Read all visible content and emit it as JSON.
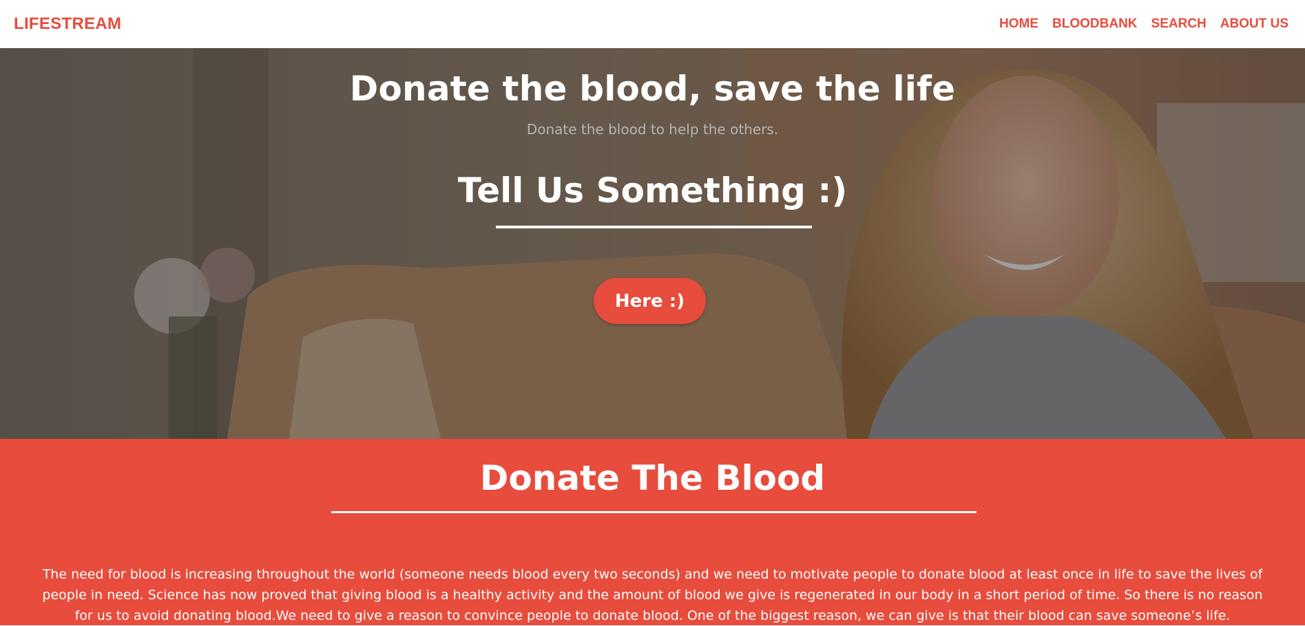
{
  "navbar": {
    "brand": "LIFESTREAM",
    "links": [
      "HOME",
      "BLOODBANK",
      "SEARCH",
      "ABOUT US"
    ]
  },
  "hero": {
    "title": "Donate the blood, save the life",
    "subtitle": "Donate the blood to help the others.",
    "heading": "Tell Us Something :)",
    "button_label": "Here :)"
  },
  "donate": {
    "title": "Donate The Blood",
    "text": "The need for blood is increasing throughout the world (someone needs blood every two seconds) and we need to motivate people to donate blood at least once in life to save the lives of people in need. Science has now proved that giving blood is a healthy activity and the amount of blood we give is regenerated in our body in a short period of time. So there is no reason for us to avoid donating blood.We need to give a reason to convince people to donate blood. One of the biggest reason, we can give is that their blood can save someone’s life."
  },
  "colors": {
    "accent": "#e74c3c",
    "hero_overlay": "#000000"
  }
}
